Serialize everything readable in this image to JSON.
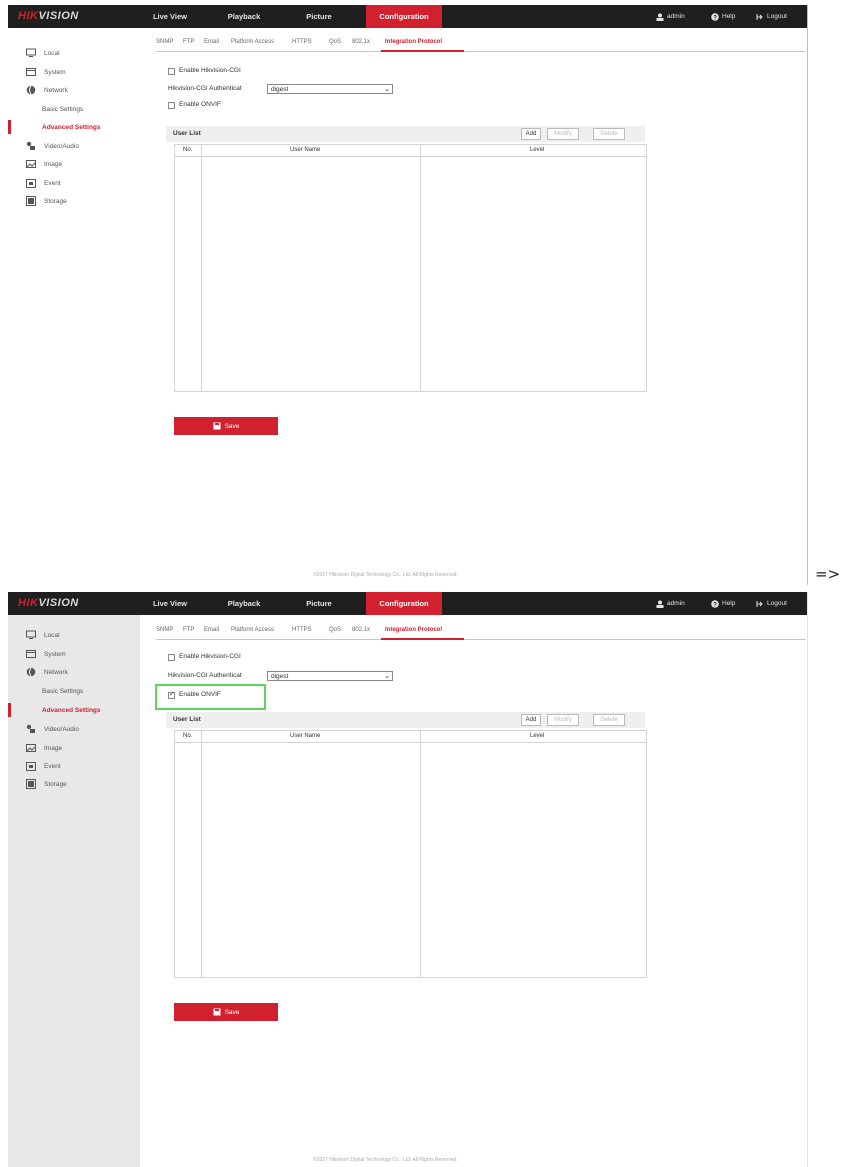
{
  "brand": {
    "part1": "HIK",
    "part2": "VISION"
  },
  "topnav": [
    "Live View",
    "Playback",
    "Picture",
    "Configuration"
  ],
  "topnav_active": "Configuration",
  "user": {
    "username": "admin",
    "help": "Help",
    "logout": "Logout"
  },
  "sidebar": {
    "items": [
      "Local",
      "System",
      "Network",
      "Basic Settings",
      "Advanced Settings",
      "Video/Audio",
      "Image",
      "Event",
      "Storage"
    ],
    "active": "Advanced Settings"
  },
  "subtabs": [
    "SNMP",
    "FTP",
    "Email",
    "Platform Access",
    "HTTPS",
    "QoS",
    "802.1x",
    "Integration Protocol"
  ],
  "subtab_active": "Integration Protocol",
  "form": {
    "enable_cgi_label": "Enable Hikvision-CGI",
    "cgi_auth_label": "Hikvision-CGI Authenticat",
    "cgi_auth_value": "digest",
    "enable_onvif_label": "Enable ONVIF"
  },
  "user_list": {
    "title": "User List",
    "add_label": "Add",
    "modify_label": "Modify",
    "delete_label": "Delete",
    "columns": [
      "No.",
      "User Name",
      "Level"
    ]
  },
  "save_label": "Save",
  "copyright": "©2017 Hikvision Digital Technology Co., Ltd. All Rights Reserved.",
  "transition_arrow": "=>",
  "states": [
    {
      "enable_cgi": false,
      "enable_onvif": false,
      "onvif_highlighted": false
    },
    {
      "enable_cgi": false,
      "enable_onvif": true,
      "onvif_highlighted": true
    }
  ],
  "colors": {
    "accent": "#d2212e",
    "topbar": "#1f1f1f",
    "highlight": "#5fd35f"
  }
}
